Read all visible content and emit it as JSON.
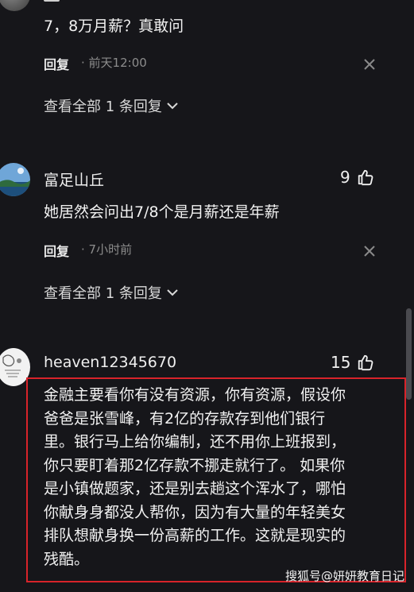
{
  "comments": [
    {
      "text": "7，8万月薪？真敢问",
      "reply_label": "回复",
      "time": "前天12:00",
      "view_replies": "查看全部 1 条回复"
    },
    {
      "username": "富足山丘",
      "likes": "9",
      "text": "她居然会问出7/8个是月薪还是年薪",
      "reply_label": "回复",
      "time": "7小时前",
      "view_replies": "查看全部 1 条回复"
    },
    {
      "username": "heaven12345670",
      "likes": "15",
      "text_lines": [
        "金融主要看你有没有资源，你有资源，假设你",
        "爸爸是张雪峰，有2亿的存款存到他们银行",
        "里。银行马上给你编制，还不用你上班报到，",
        "你只要盯着那2亿存款不挪走就行了。 如果你",
        "是小镇做题家，还是别去趟这个浑水了，哪怕",
        "你献身身都没人帮你，因为有大量的年轻美女",
        "排队想献身换一份高薪的工作。这就是现实的",
        "残酷。"
      ]
    }
  ],
  "watermark": "搜狐号@妍妍教育日记",
  "icons": {
    "thumb": "thumbs-up-icon",
    "close": "close-icon",
    "chevron": "chevron-down-icon"
  },
  "colors": {
    "background": "#16161a",
    "highlight_border": "#d8232a"
  }
}
